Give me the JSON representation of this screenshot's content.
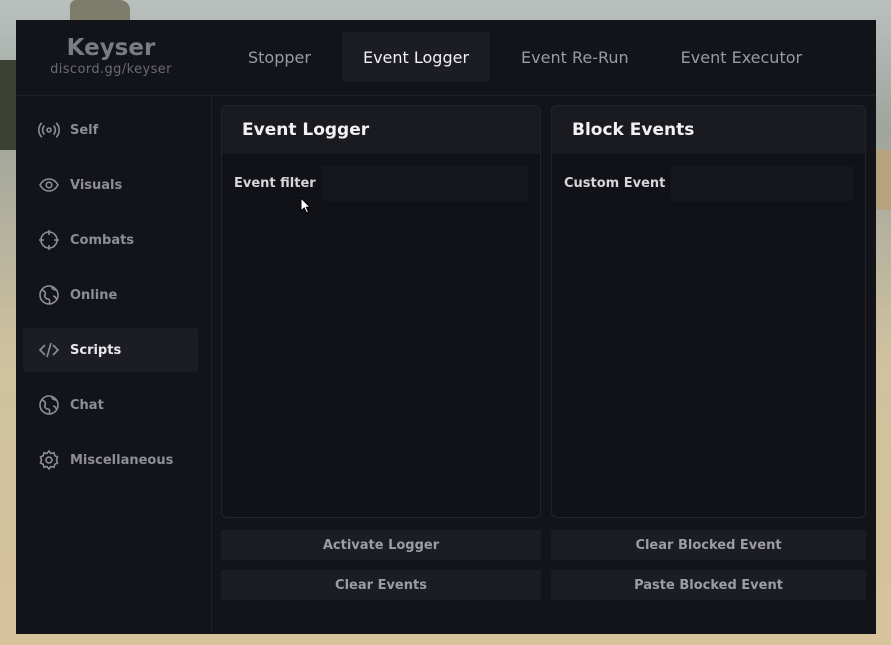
{
  "brand": {
    "name": "Keyser",
    "subtitle": "discord.gg/keyser"
  },
  "tabs": [
    {
      "label": "Stopper",
      "active": false
    },
    {
      "label": "Event Logger",
      "active": true
    },
    {
      "label": "Event Re-Run",
      "active": false
    },
    {
      "label": "Event Executor",
      "active": false
    }
  ],
  "sidebar": {
    "items": [
      {
        "label": "Self",
        "icon": "broadcast-icon"
      },
      {
        "label": "Visuals",
        "icon": "eye-icon"
      },
      {
        "label": "Combats",
        "icon": "crosshair-icon"
      },
      {
        "label": "Online",
        "icon": "globe-icon"
      },
      {
        "label": "Scripts",
        "icon": "code-icon",
        "active": true
      },
      {
        "label": "Chat",
        "icon": "globe-icon"
      },
      {
        "label": "Miscellaneous",
        "icon": "gear-icon"
      }
    ]
  },
  "event_logger": {
    "title": "Event Logger",
    "filter_label": "Event filter",
    "filter_value": "",
    "activate_label": "Activate Logger",
    "clear_label": "Clear Events"
  },
  "block_events": {
    "title": "Block Events",
    "custom_label": "Custom Event",
    "custom_value": "",
    "clear_blocked_label": "Clear Blocked Event",
    "paste_blocked_label": "Paste Blocked Event"
  },
  "colors": {
    "window_bg": "#13141a",
    "active_bg": "#1c1d24",
    "text_muted": "#8d8e94"
  }
}
